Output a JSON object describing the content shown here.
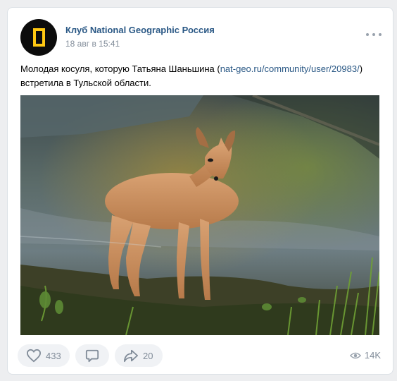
{
  "post": {
    "author": "Клуб National Geographic Россия",
    "time": "18 авг в 15:41",
    "text_before": "Молодая косуля, которую Татьяна Шаньшина (",
    "link": "nat-geo.ru/community/user/20983/",
    "text_after": ") встретила в Тульской области."
  },
  "actions": {
    "likes": "433",
    "shares": "20",
    "views": "14K"
  },
  "colors": {
    "accent": "#2a5885",
    "brand_yellow": "#ffc812",
    "muted": "#818c99"
  },
  "icons": [
    "national-geographic-logo",
    "more-icon",
    "heart-icon",
    "comment-icon",
    "share-icon",
    "eye-icon"
  ]
}
